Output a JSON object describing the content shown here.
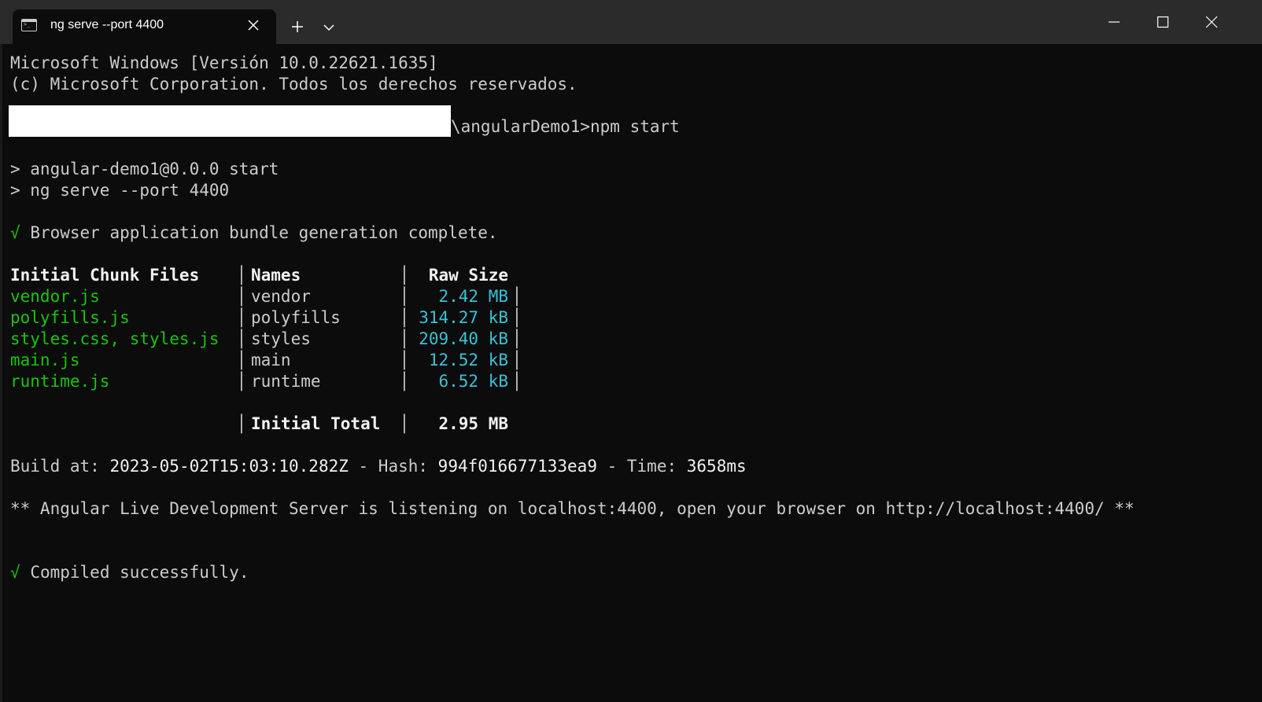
{
  "window": {
    "tab_title": "ng serve --port 4400",
    "colors": {
      "titlebar": "#2b2b2b",
      "terminal_bg": "#0c0c0c",
      "text": "#cccccc",
      "green": "#16c60c",
      "cyan": "#3ac1d6"
    }
  },
  "terminal": {
    "header_line1": "Microsoft Windows [Versión 10.0.22621.1635]",
    "header_line2": "(c) Microsoft Corporation. Todos los derechos reservados.",
    "command_path": "\\angularDemo1>npm start",
    "npm_line1": "> angular-demo1@0.0.0 start",
    "npm_line2": "> ng serve --port 4400",
    "check_symbol": "√",
    "bundle_msg": "Browser application bundle generation complete.",
    "table": {
      "headers": [
        "Initial Chunk Files",
        "Names",
        "Raw Size"
      ],
      "rows": [
        {
          "file": "vendor.js",
          "name": "vendor",
          "size": "2.42 MB"
        },
        {
          "file": "polyfills.js",
          "name": "polyfills",
          "size": "314.27 kB"
        },
        {
          "file": "styles.css, styles.js",
          "name": "styles",
          "size": "209.40 kB"
        },
        {
          "file": "main.js",
          "name": "main",
          "size": "12.52 kB"
        },
        {
          "file": "runtime.js",
          "name": "runtime",
          "size": "6.52 kB"
        }
      ],
      "total_label": "Initial Total",
      "total_value": "2.95 MB"
    },
    "build": {
      "at_label": "Build at: ",
      "at_value": "2023-05-02T15:03:10.282Z",
      "hash_label": " - Hash: ",
      "hash_value": "994f016677133ea9",
      "time_label": " - Time: ",
      "time_value": "3658ms"
    },
    "server_msg": "** Angular Live Development Server is listening on localhost:4400, open your browser on http://localhost:4400/ **",
    "compiled_msg": "Compiled successfully."
  }
}
